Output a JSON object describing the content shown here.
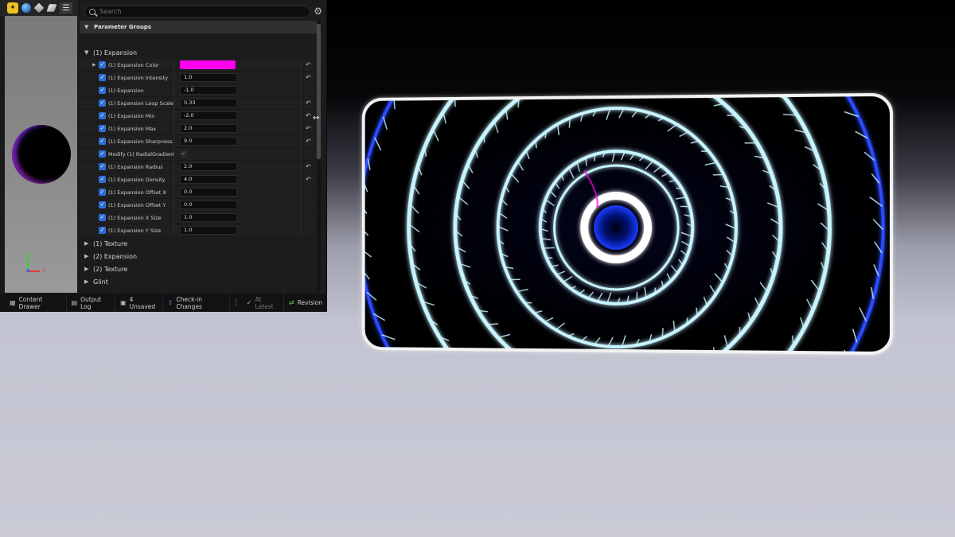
{
  "toolbar": {
    "logo_icon": "material-logo-icon",
    "sphere_icon": "sphere-preview-icon",
    "cube_icon": "cube-preview-icon",
    "eraser_icon": "eraser-icon",
    "menu_icon": "hamburger-menu-icon"
  },
  "search": {
    "placeholder": "Search"
  },
  "details": {
    "group_header": "Parameter Groups",
    "categories_top": [
      {
        "label": "(1) Expansion",
        "expanded": true
      }
    ],
    "params": [
      {
        "name": "(1) Expansion Color",
        "kind": "color",
        "color": "#ff00ee",
        "expander": true,
        "reset": true
      },
      {
        "name": "(1) Expansion Intensity",
        "kind": "value",
        "value": "1.0",
        "reset": true
      },
      {
        "name": "(1) Expansion",
        "kind": "value",
        "value": "-1.0",
        "reset": false
      },
      {
        "name": "(1) Expansion Loop Scale",
        "kind": "value",
        "value": "0.33",
        "reset": true
      },
      {
        "name": "(1) Expansion Min",
        "kind": "value",
        "value": "-2.0",
        "reset": true
      },
      {
        "name": "(1) Expansion Max",
        "kind": "value",
        "value": "2.0",
        "reset": true
      },
      {
        "name": "(1) Expansion Sharpness",
        "kind": "value",
        "value": "9.0",
        "reset": true
      },
      {
        "name": "Modify (1) RadialGradient...",
        "kind": "bool",
        "value": "✓",
        "reset": false
      },
      {
        "name": "(1) Expansion Radius",
        "kind": "value",
        "value": "2.0",
        "reset": true
      },
      {
        "name": "(1) Expansion Density",
        "kind": "value",
        "value": "4.0",
        "reset": true
      },
      {
        "name": "(1) Expansion Offset X",
        "kind": "value",
        "value": "0.0",
        "reset": false
      },
      {
        "name": "(1) Expansion Offset Y",
        "kind": "value",
        "value": "0.0",
        "reset": false
      },
      {
        "name": "(1) Expansion X Size",
        "kind": "value",
        "value": "1.0",
        "reset": false
      },
      {
        "name": "(1) Expansion Y Size",
        "kind": "value",
        "value": "1.0",
        "reset": false
      }
    ],
    "categories_bottom": [
      {
        "label": "(1) Texture"
      },
      {
        "label": "(2) Expansion"
      },
      {
        "label": "(2) Texture"
      },
      {
        "label": "Glint"
      }
    ]
  },
  "viewport": {
    "axis_label": "L"
  },
  "statusbar": {
    "content_drawer": "Content Drawer",
    "output_log": "Output Log",
    "unsaved": "4 Unsaved",
    "checkin": "Check-in Changes",
    "at_latest": "At Latest",
    "revision": "Revision"
  },
  "colors": {
    "accent_blue": "#2f6fd8",
    "expansion_color": "#ff00ee",
    "ring_glow": "#c8f4ff",
    "ring_blue": "#2a4cff"
  }
}
